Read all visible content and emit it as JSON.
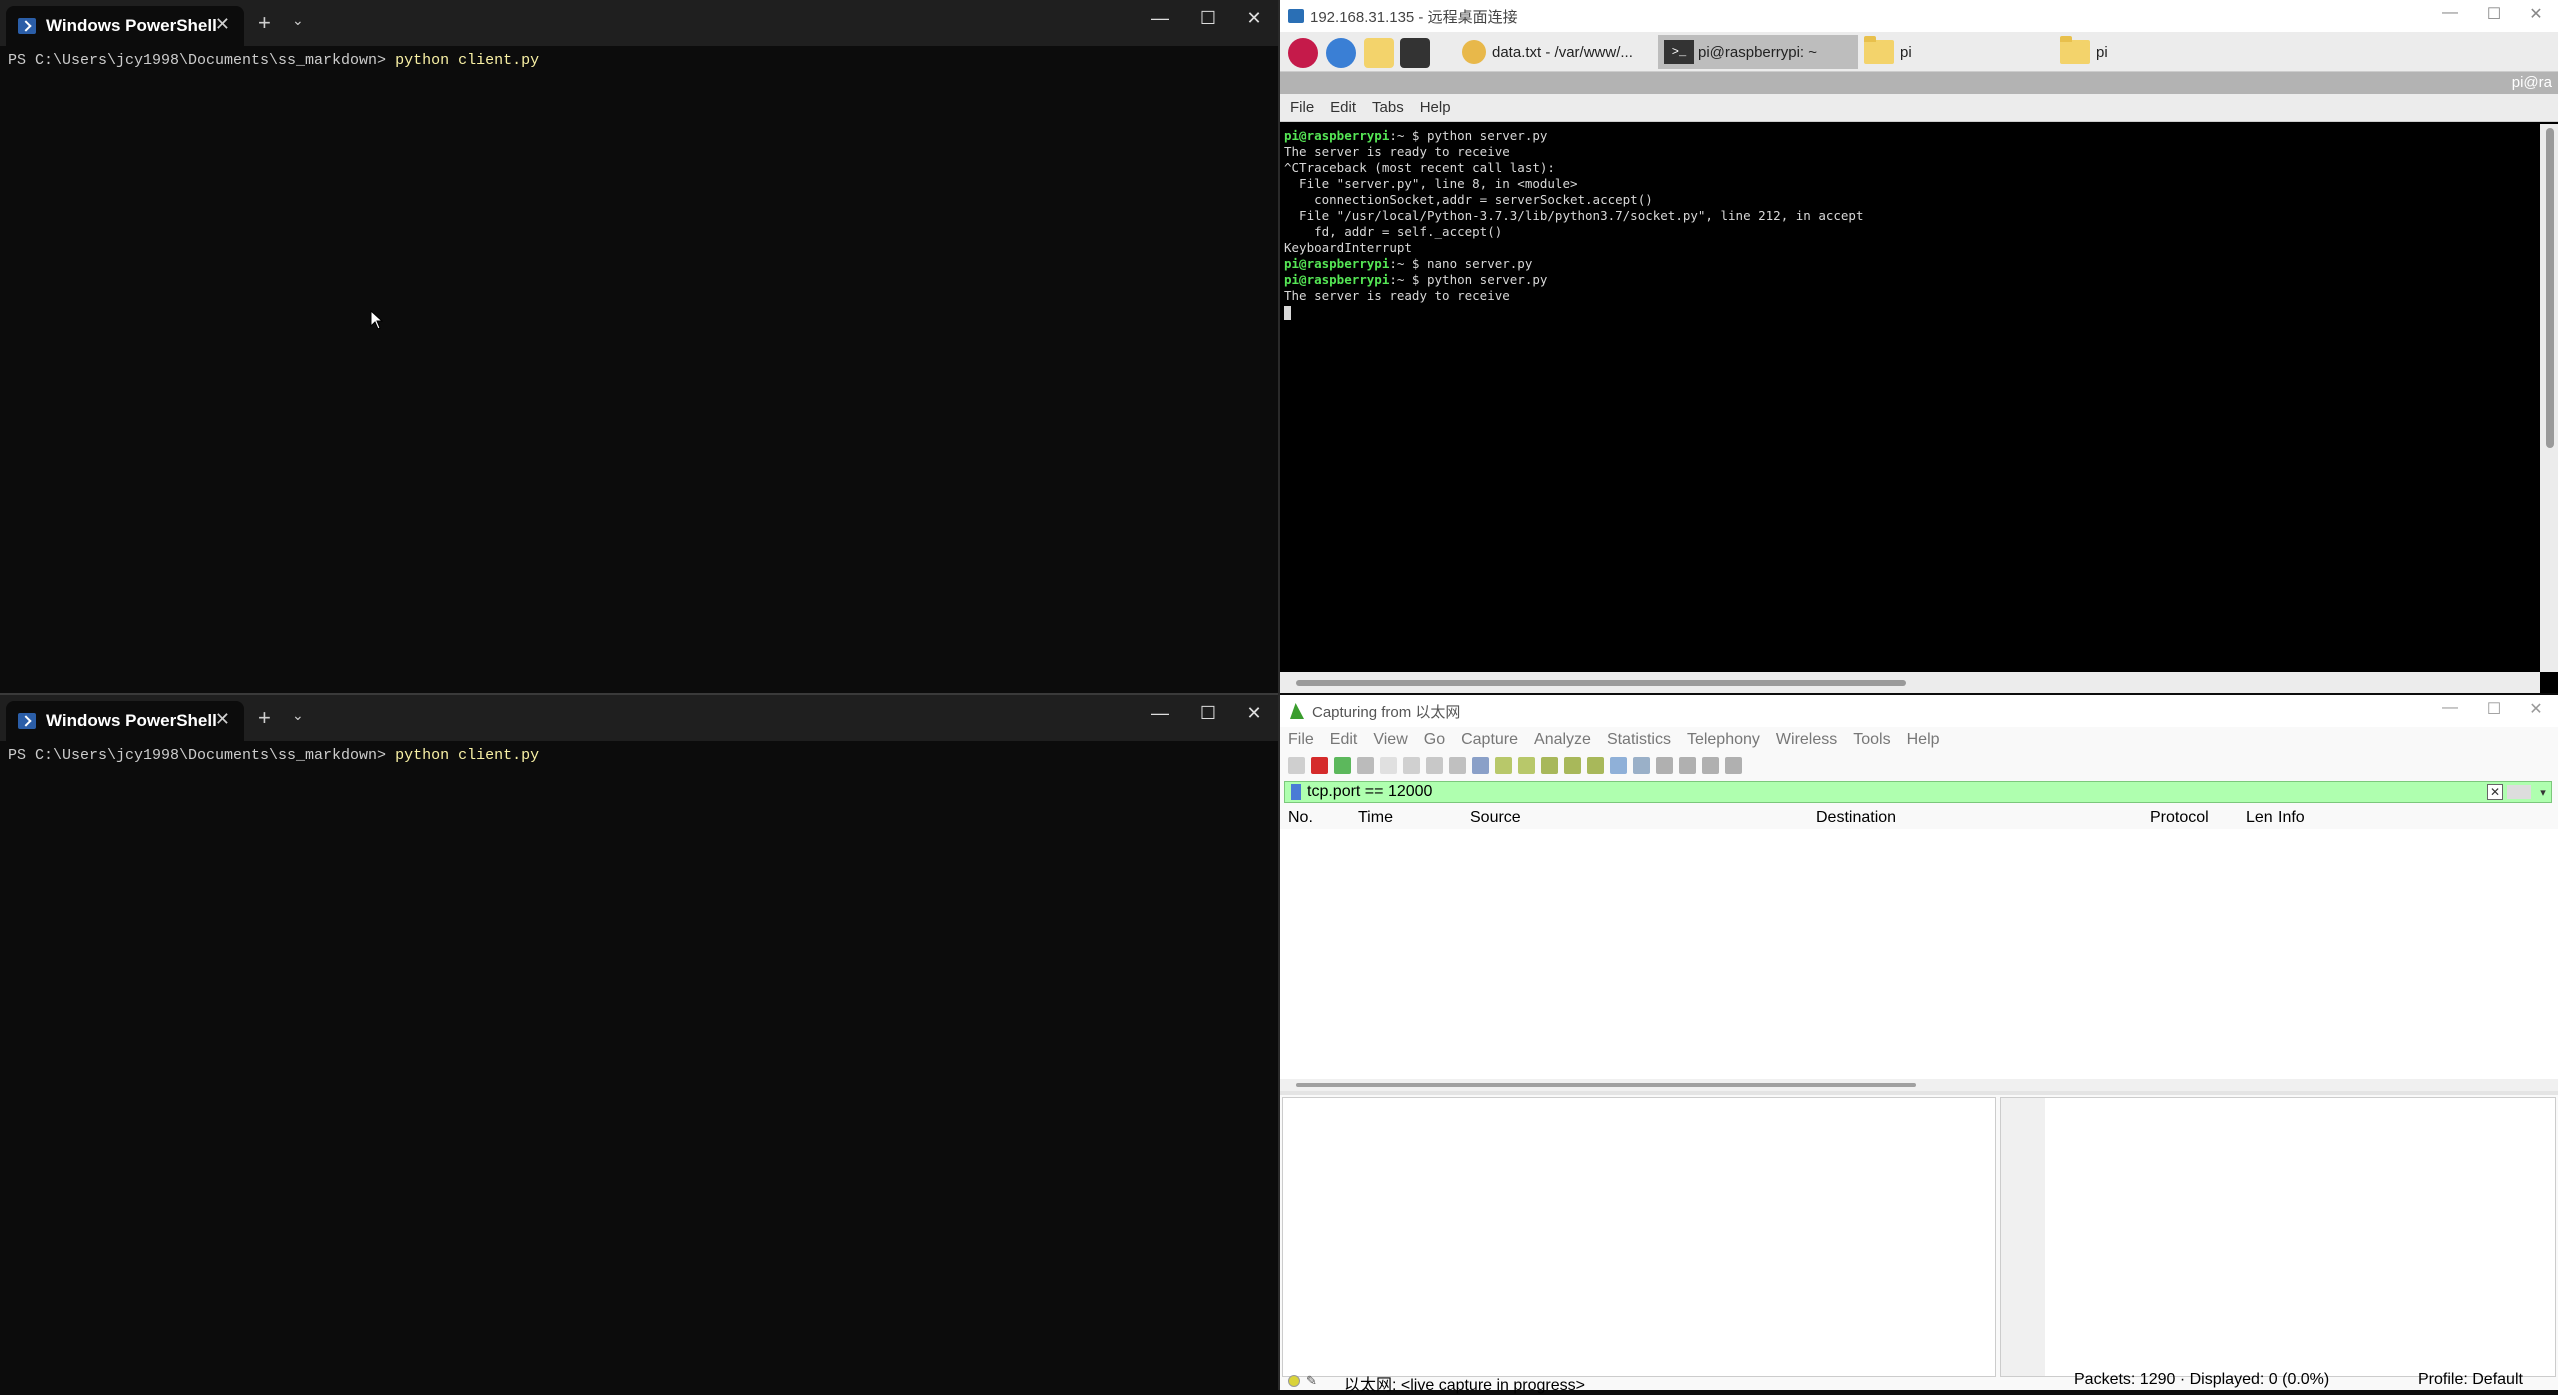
{
  "ps_top": {
    "tab_title": "Windows PowerShell",
    "prompt": "PS C:\\Users\\jcy1998\\Documents\\ss_markdown> ",
    "command": "python client.py"
  },
  "ps_bottom": {
    "tab_title": "Windows PowerShell",
    "prompt": "PS C:\\Users\\jcy1998\\Documents\\ss_markdown> ",
    "command": "python client.py"
  },
  "rdp": {
    "title": "192.168.31.135 - 远程桌面连接",
    "taskbar": {
      "task1": "data.txt - /var/www/...",
      "task2": "pi@raspberrypi: ~",
      "task3": "pi",
      "task4": "pi"
    },
    "grayband_text": "pi@ra",
    "menu": [
      "File",
      "Edit",
      "Tabs",
      "Help"
    ],
    "terminal": {
      "l1_user": "pi@raspberrypi",
      "l1_rest": ":~ $ python server.py",
      "l2": "The server is ready to receive",
      "l3": "^CTraceback (most recent call last):",
      "l4": "  File \"server.py\", line 8, in <module>",
      "l5": "    connectionSocket,addr = serverSocket.accept()",
      "l6": "  File \"/usr/local/Python-3.7.3/lib/python3.7/socket.py\", line 212, in accept",
      "l7": "    fd, addr = self._accept()",
      "l8": "KeyboardInterrupt",
      "l9_user": "pi@raspberrypi",
      "l9_rest": ":~ $ nano server.py",
      "l10_user": "pi@raspberrypi",
      "l10_rest": ":~ $ python server.py",
      "l11": "The server is ready to receive"
    }
  },
  "wireshark": {
    "title": "Capturing from 以太网",
    "menu": [
      "File",
      "Edit",
      "View",
      "Go",
      "Capture",
      "Analyze",
      "Statistics",
      "Telephony",
      "Wireless",
      "Tools",
      "Help"
    ],
    "filter": "tcp.port == 12000",
    "columns": [
      "No.",
      "Time",
      "Source",
      "Destination",
      "Protocol",
      "Len",
      "Info"
    ],
    "status": {
      "interface": "以太网: <live capture in progress>",
      "packets": "Packets: 1290 · Displayed: 0 (0.0%)",
      "profile": "Profile: Default"
    }
  },
  "colors": {
    "terminal_bg": "#0c0c0c",
    "command_yellow": "#f9f1a5",
    "filter_green": "#afffaf",
    "prompt_green": "#55e655"
  }
}
